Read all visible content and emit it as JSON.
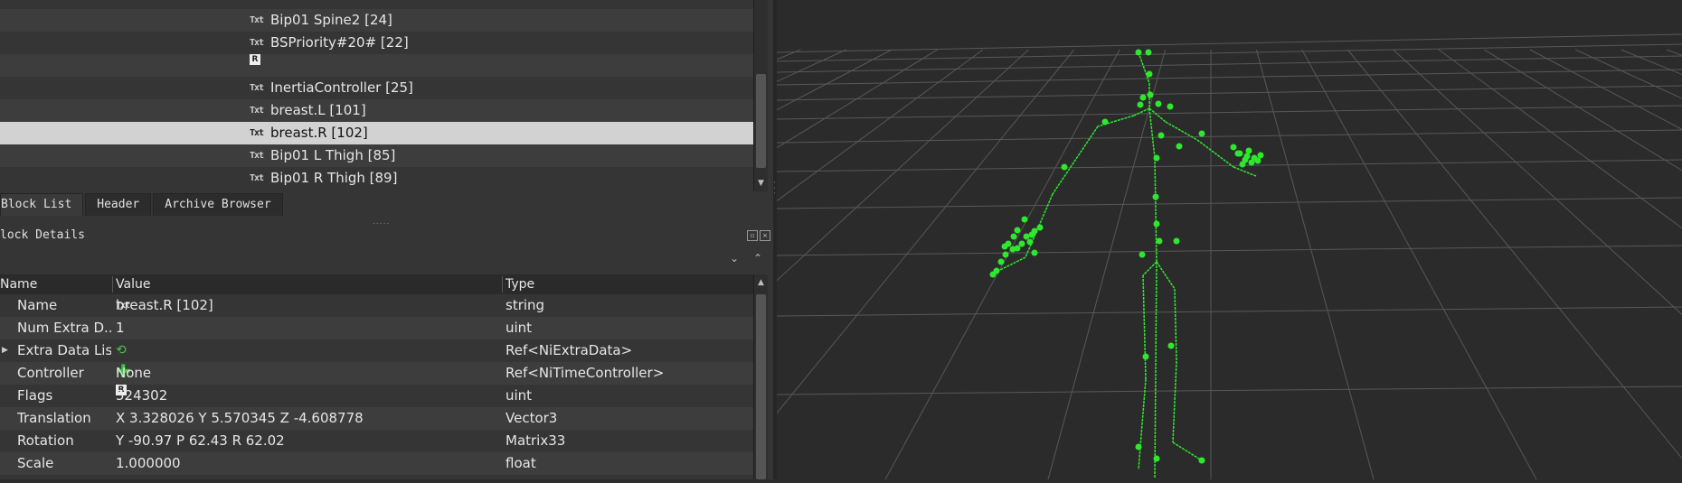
{
  "tree": {
    "rows": [
      {
        "icon": "Txt",
        "label": "Bip01 Spine2 [24]",
        "selected": false
      },
      {
        "icon": "Txt",
        "label": "BSPriority#20# [22]",
        "selected": false
      },
      {
        "icon": "R",
        "label": "",
        "selected": false
      },
      {
        "icon": "Txt",
        "label": "InertiaController [25]",
        "selected": false
      },
      {
        "icon": "Txt",
        "label": "breast.L [101]",
        "selected": false
      },
      {
        "icon": "Txt",
        "label": "breast.R [102]",
        "selected": true
      },
      {
        "icon": "Txt",
        "label": "Bip01 L Thigh [85]",
        "selected": false
      },
      {
        "icon": "Txt",
        "label": "Bip01 R Thigh [89]",
        "selected": false
      }
    ],
    "row0": "Bip01 Spine2 [24]",
    "row1": "BSPriority#20# [22]",
    "row3": "InertiaController [25]",
    "row4": "breast.L [101]",
    "row5": "breast.R [102]",
    "row6": "Bip01 L Thigh [85]",
    "row7": "Bip01 R Thigh [89]"
  },
  "tabs": {
    "block_list": "Block List",
    "header": "Header",
    "archive_browser": "Archive Browser"
  },
  "details": {
    "title": "lock Details",
    "columns": {
      "name": "Name",
      "value": "Value",
      "type": "Type"
    },
    "rows": {
      "name": {
        "name": "Name",
        "value": "breast.R [102]",
        "type": "string"
      },
      "num_extra": {
        "name": "Num Extra D...",
        "value": "1",
        "type": "uint"
      },
      "extra_list": {
        "name": "Extra Data List",
        "value": "",
        "type": "Ref<NiExtraData>"
      },
      "controller": {
        "name": "Controller",
        "value": "None",
        "type": "Ref<NiTimeController>"
      },
      "flags": {
        "name": "Flags",
        "value": "524302",
        "type": "uint"
      },
      "translation": {
        "name": "Translation",
        "value": "X 3.328026 Y 5.570345 Z -4.608778",
        "type": "Vector3"
      },
      "rotation": {
        "name": "Rotation",
        "value": "Y -90.97 P 62.43 R 62.02",
        "type": "Matrix33"
      },
      "scale": {
        "name": "Scale",
        "value": "1.000000",
        "type": "float"
      }
    }
  },
  "viewport": {
    "grid_color": "#555555",
    "bone_color": "#2ee82e"
  }
}
